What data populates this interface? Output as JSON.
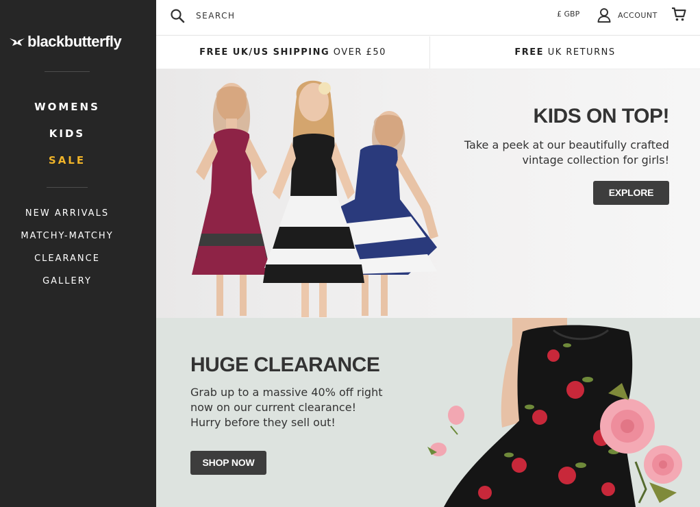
{
  "brand": {
    "name": "blackbutterfly"
  },
  "nav": {
    "main": [
      {
        "label": "WOMENS"
      },
      {
        "label": "KIDS"
      },
      {
        "label": "SALE"
      }
    ],
    "sub": [
      {
        "label": "NEW ARRIVALS"
      },
      {
        "label": "MATCHY-MATCHY"
      },
      {
        "label": "CLEARANCE"
      },
      {
        "label": "GALLERY"
      }
    ]
  },
  "header": {
    "search_placeholder": "SEARCH",
    "currency": "£ GBP",
    "account_label": "ACCOUNT"
  },
  "shipping": {
    "left_bold": "FREE UK/US SHIPPING",
    "left_rest": " OVER £50",
    "right_bold": "FREE",
    "right_rest": " UK RETURNS"
  },
  "hero_kids": {
    "title": "KIDS ON TOP!",
    "text": "Take a peek at our beautifully crafted vintage collection for girls!",
    "button": "EXPLORE"
  },
  "hero_clearance": {
    "title": "HUGE CLEARANCE",
    "text": "Grab up to a massive 40% off right now on our current clearance! Hurry before they sell out!",
    "button": "SHOP NOW"
  },
  "colors": {
    "sidebar": "#262626",
    "sale": "#f0b429",
    "button": "#3d3d3d",
    "clearance_bg": "#dde3df"
  }
}
